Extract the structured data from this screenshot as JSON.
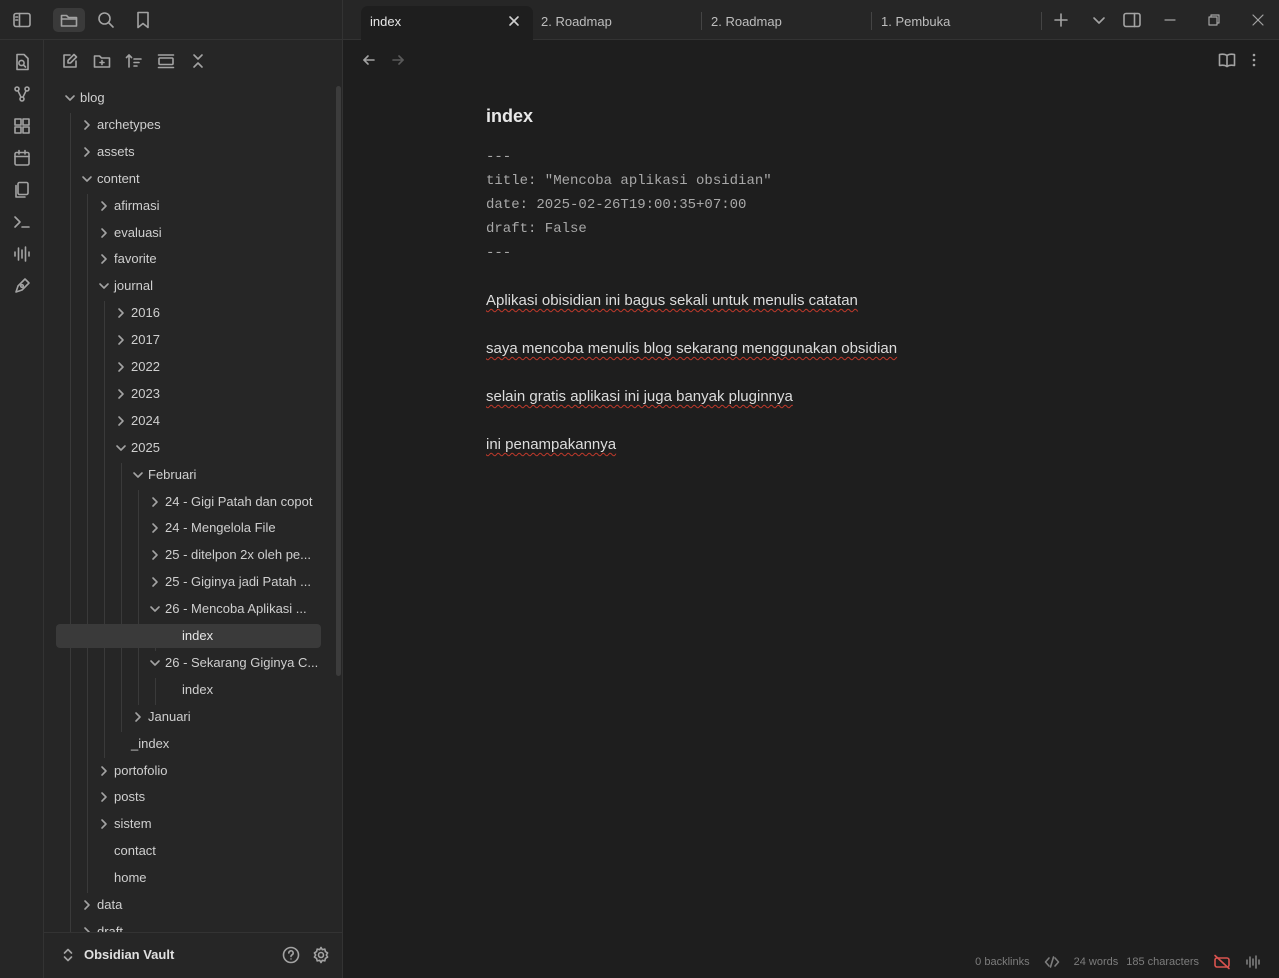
{
  "tabs": [
    {
      "label": "index",
      "active": true
    },
    {
      "label": "2. Roadmap",
      "active": false
    },
    {
      "label": "2. Roadmap",
      "active": false
    },
    {
      "label": "1. Pembuka",
      "active": false
    }
  ],
  "tree": [
    {
      "label": "blog",
      "depth": 0,
      "state": "open"
    },
    {
      "label": "archetypes",
      "depth": 1,
      "state": "closed"
    },
    {
      "label": "assets",
      "depth": 1,
      "state": "closed"
    },
    {
      "label": "content",
      "depth": 1,
      "state": "open"
    },
    {
      "label": "afirmasi",
      "depth": 2,
      "state": "closed"
    },
    {
      "label": "evaluasi",
      "depth": 2,
      "state": "closed"
    },
    {
      "label": "favorite",
      "depth": 2,
      "state": "closed"
    },
    {
      "label": "journal",
      "depth": 2,
      "state": "open"
    },
    {
      "label": "2016",
      "depth": 3,
      "state": "closed"
    },
    {
      "label": "2017",
      "depth": 3,
      "state": "closed"
    },
    {
      "label": "2022",
      "depth": 3,
      "state": "closed"
    },
    {
      "label": "2023",
      "depth": 3,
      "state": "closed"
    },
    {
      "label": "2024",
      "depth": 3,
      "state": "closed"
    },
    {
      "label": "2025",
      "depth": 3,
      "state": "open"
    },
    {
      "label": "Februari",
      "depth": 4,
      "state": "open"
    },
    {
      "label": "24 - Gigi Patah dan copot",
      "depth": 5,
      "state": "closed"
    },
    {
      "label": "24 - Mengelola File",
      "depth": 5,
      "state": "closed"
    },
    {
      "label": "25 - ditelpon 2x oleh pe...",
      "depth": 5,
      "state": "closed"
    },
    {
      "label": "25 - Giginya jadi Patah ...",
      "depth": 5,
      "state": "closed"
    },
    {
      "label": "26 - Mencoba Aplikasi ...",
      "depth": 5,
      "state": "open"
    },
    {
      "label": "index",
      "depth": 6,
      "state": "file",
      "selected": true
    },
    {
      "label": "26 - Sekarang Giginya C...",
      "depth": 5,
      "state": "open"
    },
    {
      "label": "index",
      "depth": 6,
      "state": "file"
    },
    {
      "label": "Januari",
      "depth": 4,
      "state": "closed"
    },
    {
      "label": "_index",
      "depth": 3,
      "state": "file"
    },
    {
      "label": "portofolio",
      "depth": 2,
      "state": "closed"
    },
    {
      "label": "posts",
      "depth": 2,
      "state": "closed"
    },
    {
      "label": "sistem",
      "depth": 2,
      "state": "closed"
    },
    {
      "label": "contact",
      "depth": 2,
      "state": "file"
    },
    {
      "label": "home",
      "depth": 2,
      "state": "file"
    },
    {
      "label": "data",
      "depth": 1,
      "state": "closed"
    },
    {
      "label": "draft",
      "depth": 1,
      "state": "closed"
    }
  ],
  "vault": {
    "name": "Obsidian Vault"
  },
  "note": {
    "title": "index",
    "frontmatter": [
      "---",
      "title: \"Mencoba aplikasi obsidian\"",
      "date: 2025-02-26T19:00:35+07:00",
      "draft: False",
      "---"
    ],
    "paragraphs": [
      "Aplikasi obisidian ini bagus sekali untuk menulis catatan",
      "saya mencoba menulis blog sekarang menggunakan obsidian",
      "selain gratis aplikasi ini juga banyak pluginnya",
      "ini penampakannya"
    ]
  },
  "status": {
    "backlinks": "0 backlinks",
    "words": "24 words",
    "characters": "185 characters"
  },
  "icons": [
    "sidebar-toggle-icon",
    "folder-icon",
    "search-icon",
    "bookmark-icon",
    "quick-switcher-icon",
    "graph-icon",
    "canvas-icon",
    "calendar-icon",
    "templates-icon",
    "terminal-icon",
    "audio-recorder-icon",
    "publish-icon",
    "new-note-icon",
    "new-folder-icon",
    "sort-icon",
    "collapse-icon",
    "close-all-icon",
    "help-icon",
    "settings-icon"
  ]
}
